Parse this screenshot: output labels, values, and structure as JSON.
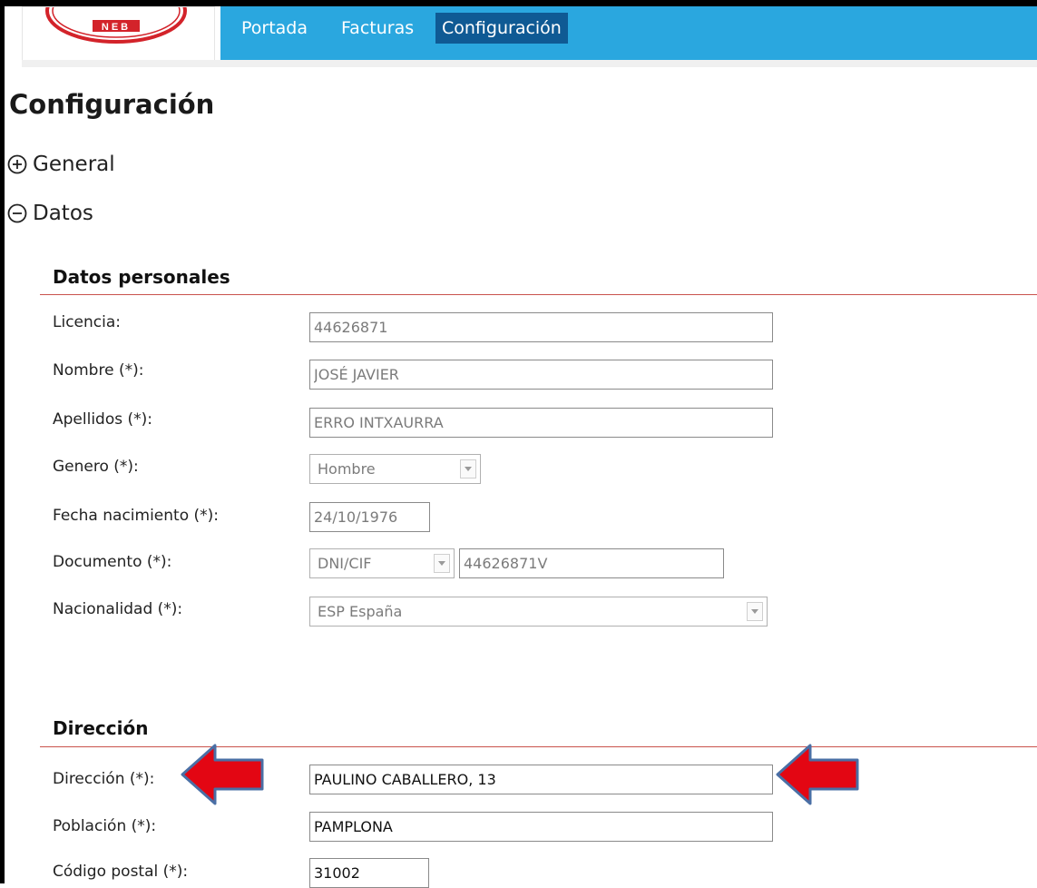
{
  "logo": {
    "text": "NEB"
  },
  "nav": {
    "items": [
      {
        "label": "Portada"
      },
      {
        "label": "Facturas"
      },
      {
        "label": "Configuración"
      }
    ],
    "active_index": 2
  },
  "page": {
    "title": "Configuración"
  },
  "sections": {
    "general": {
      "label": "General",
      "state": "collapsed",
      "icon": "plus-circle-icon"
    },
    "datos": {
      "label": "Datos",
      "state": "expanded",
      "icon": "minus-circle-icon"
    }
  },
  "datos_personales": {
    "title": "Datos personales",
    "licencia": {
      "label": "Licencia:",
      "value": "44626871"
    },
    "nombre": {
      "label": "Nombre (*):",
      "value": "JOSÉ JAVIER"
    },
    "apellidos": {
      "label": "Apellidos (*):",
      "value": "ERRO INTXAURRA"
    },
    "genero": {
      "label": "Genero (*):",
      "value": "Hombre"
    },
    "fecha_nacimiento": {
      "label": "Fecha nacimiento (*):",
      "value": "24/10/1976"
    },
    "documento": {
      "label": "Documento (*):",
      "type_value": "DNI/CIF",
      "value": "44626871V"
    },
    "nacionalidad": {
      "label": "Nacionalidad (*):",
      "value": "ESP España"
    }
  },
  "direccion": {
    "title": "Dirección",
    "direccion": {
      "label": "Dirección (*):",
      "value": "PAULINO CABALLERO, 13"
    },
    "poblacion": {
      "label": "Población (*):",
      "value": "PAMPLONA"
    },
    "codigo_postal": {
      "label": "Código postal (*):",
      "value": "31002"
    }
  },
  "colors": {
    "nav_background": "#2aa7df",
    "nav_active": "#0f5a94",
    "section_rule": "#c9524c",
    "annotation_arrow": "#e30613"
  }
}
